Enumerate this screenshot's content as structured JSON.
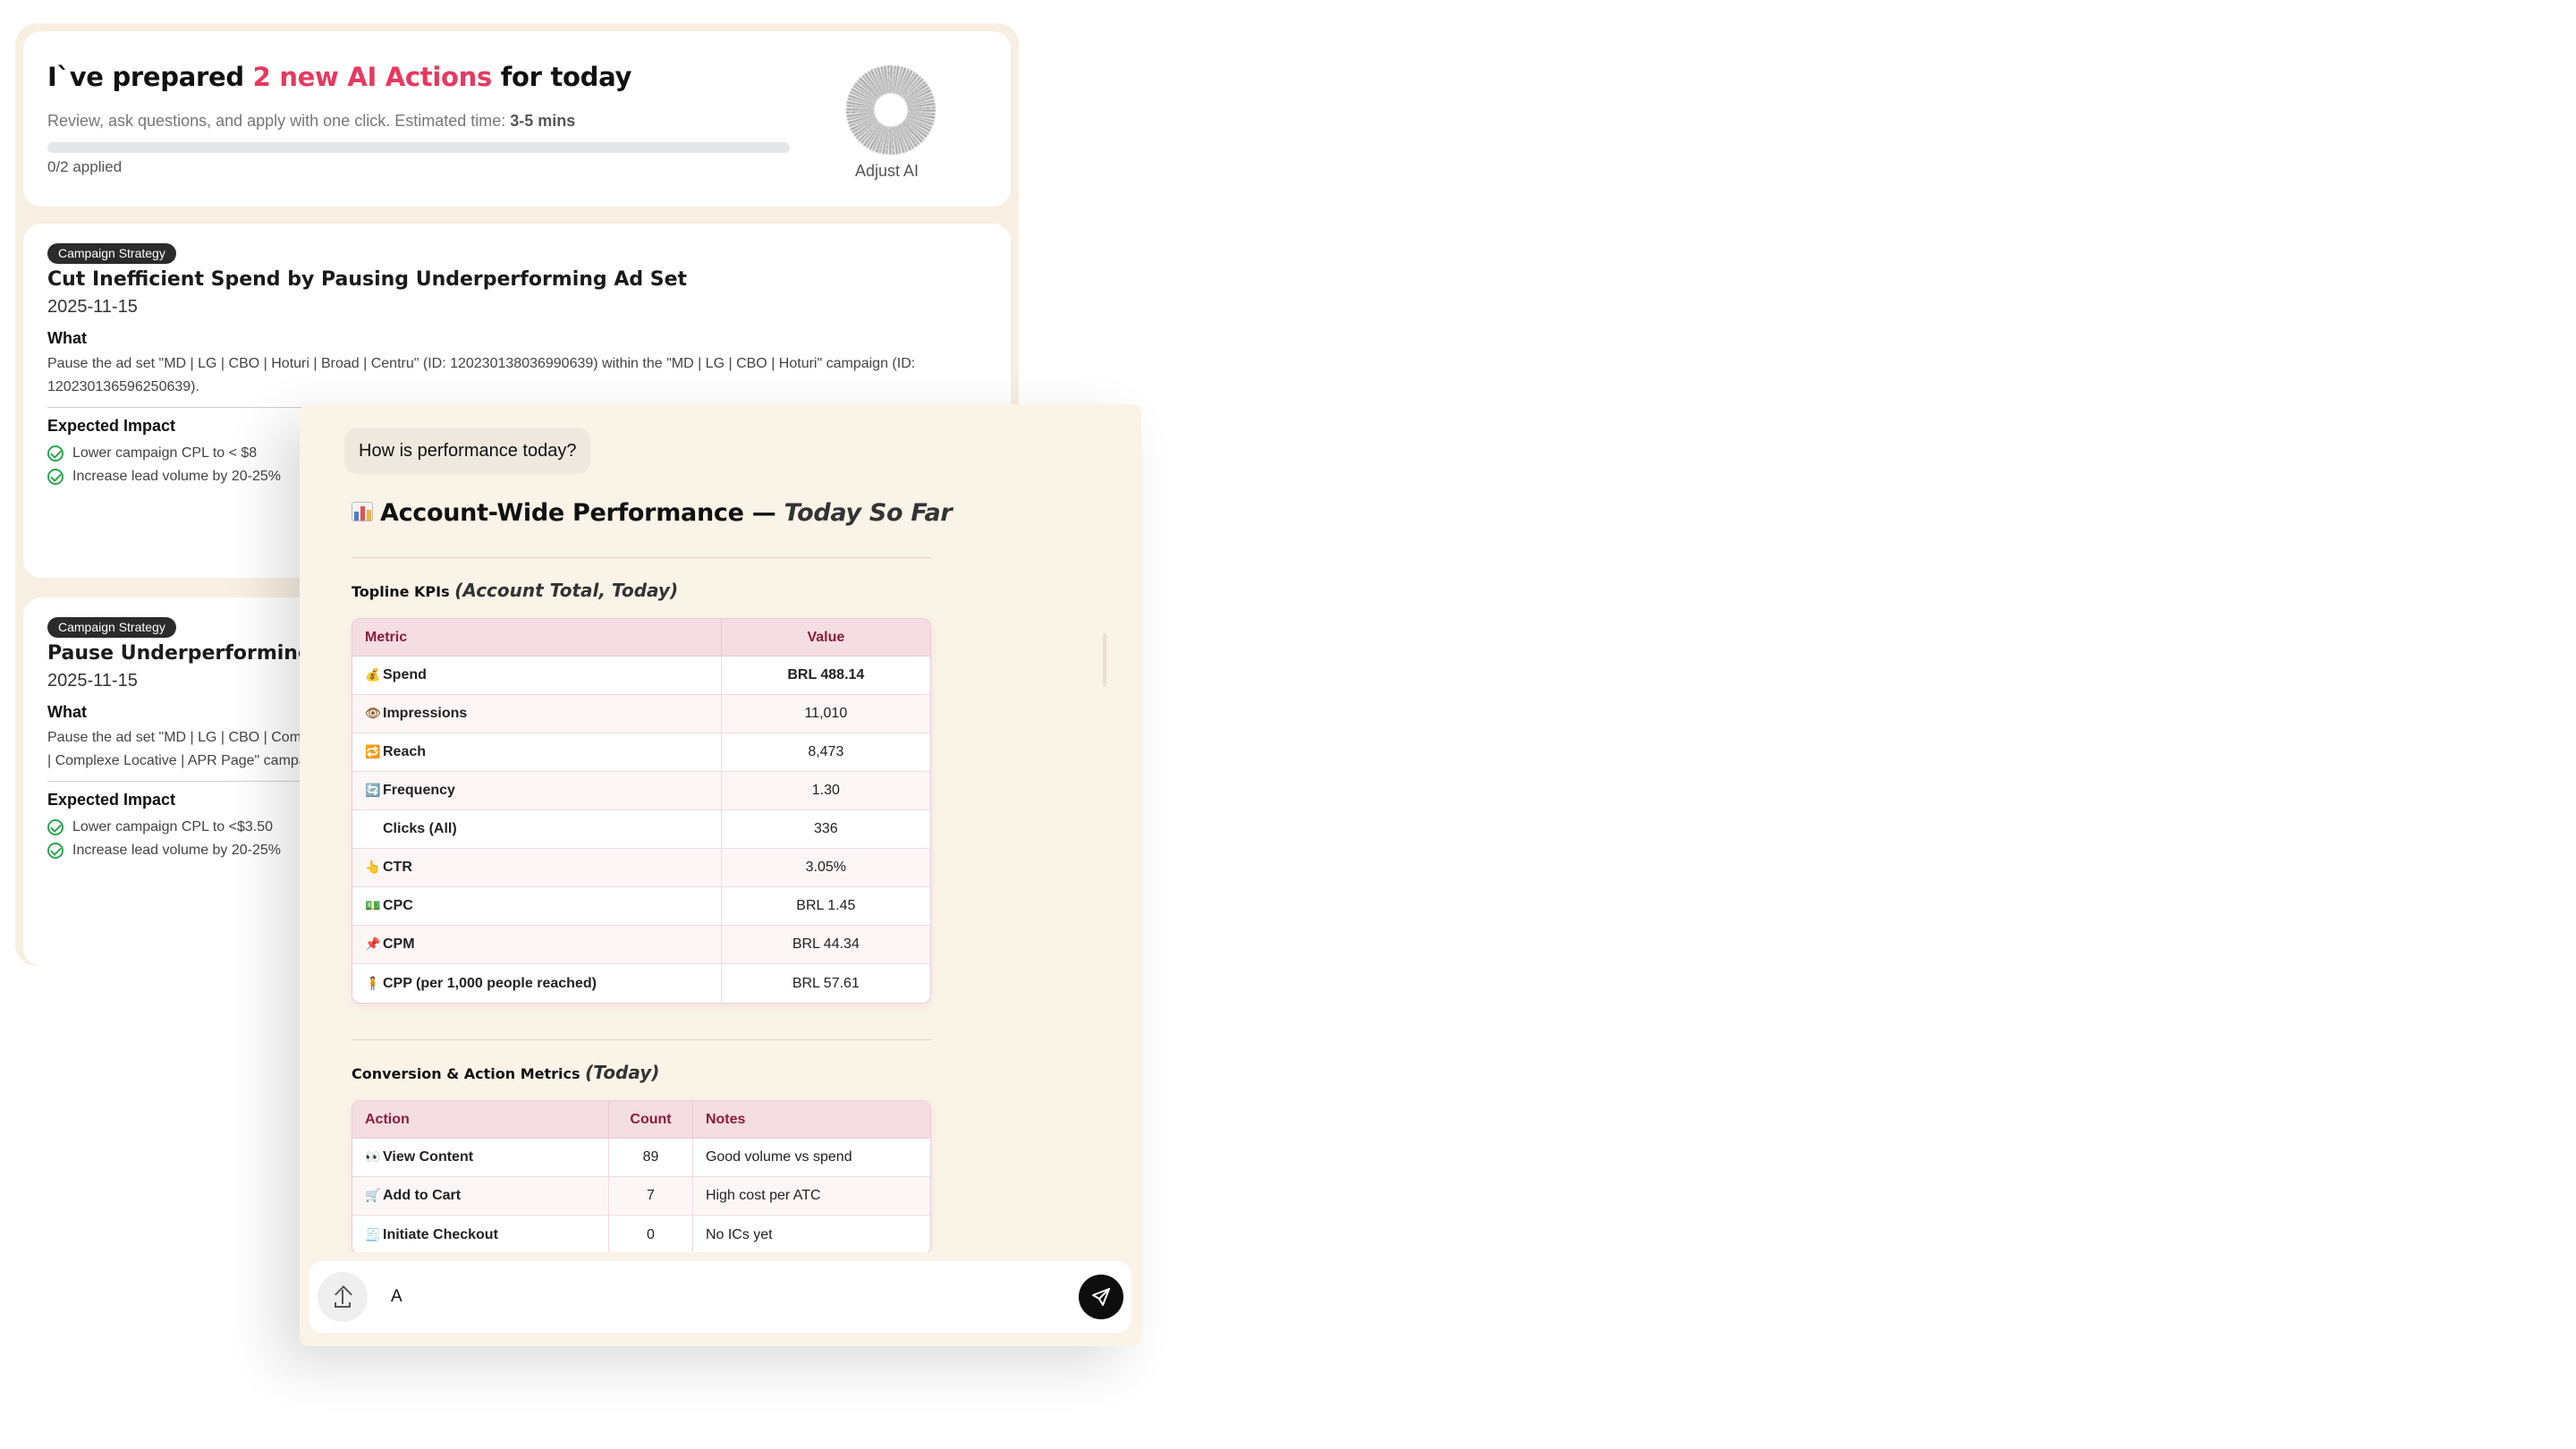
{
  "header": {
    "title_prefix": "I`ve prepared ",
    "title_highlight": "2 new AI Actions",
    "title_suffix": " for today",
    "subtitle": "Review, ask questions, and apply with one click. Estimated time: ",
    "subtitle_time": "3-5 mins",
    "progress_applied": 0,
    "progress_total": 2,
    "applied_label": "0/2 applied",
    "adjust_label": "Adjust AI",
    "accent_color": "#e6395f"
  },
  "actions": [
    {
      "badge": "Campaign Strategy",
      "title": "Cut Inefficient Spend by Pausing Underperforming Ad Set",
      "date": "2025-11-15",
      "what_heading": "What",
      "what_line1": "Pause the ad set \"MD | LG | CBO | Hoturi | Broad | Centru\" (ID: 120230138036990639) within the \"MD | LG | CBO | Hoturi\" campaign (ID:",
      "what_line2": "120230136596250639).",
      "impact_heading": "Expected Impact",
      "impacts": [
        "Lower campaign CPL to < $8",
        "Increase lead volume by 20-25%"
      ]
    },
    {
      "badge": "Campaign Strategy",
      "title": "Pause Underperforming Ad S",
      "date": "2025-11-15",
      "what_heading": "What",
      "what_line1": "Pause the ad set \"MD | LG | CBO | Comp",
      "what_line2": "| Complexe Locative | APR Page\" campa",
      "impact_heading": "Expected Impact",
      "impacts": [
        "Lower campaign CPL to <$3.50",
        "Increase lead volume by 20-25%"
      ]
    }
  ],
  "chat": {
    "user_message": "How is performance today?",
    "response_title": "Account-Wide Performance — ",
    "response_title_italic": "Today So Far",
    "topline_heading": "Topline KPIs ",
    "topline_heading_italic": "(Account Total, Today)",
    "topline_columns": [
      "Metric",
      "Value"
    ],
    "topline_rows": [
      {
        "icon": "💰",
        "metric": "Spend",
        "value": "BRL 488.14"
      },
      {
        "icon": "👁",
        "metric": "Impressions",
        "value": "11,010"
      },
      {
        "icon": "🔁",
        "metric": "Reach",
        "value": "8,473"
      },
      {
        "icon": "🔄",
        "metric": "Frequency",
        "value": "1.30"
      },
      {
        "icon": "",
        "metric": "Clicks (All)",
        "value": "336"
      },
      {
        "icon": "👆",
        "metric": "CTR",
        "value": "3.05%"
      },
      {
        "icon": "💵",
        "metric": "CPC",
        "value": "BRL 1.45"
      },
      {
        "icon": "📌",
        "metric": "CPM",
        "value": "BRL 44.34"
      },
      {
        "icon": "🧍",
        "metric": "CPP (per 1,000 people reached)",
        "value": "BRL 57.61"
      }
    ],
    "conversion_heading": "Conversion & Action Metrics ",
    "conversion_heading_italic": "(Today)",
    "conversion_columns": [
      "Action",
      "Count",
      "Notes"
    ],
    "conversion_rows": [
      {
        "icon": "👀",
        "action": "View Content",
        "count": "89",
        "notes": "Good volume vs spend"
      },
      {
        "icon": "🛒",
        "action": "Add to Cart",
        "count": "7",
        "notes": "High cost per ATC"
      },
      {
        "icon": "🧾",
        "action": "Initiate Checkout",
        "count": "0",
        "notes": "No ICs yet"
      }
    ],
    "composer_value": "A",
    "composer_placeholder": ""
  }
}
